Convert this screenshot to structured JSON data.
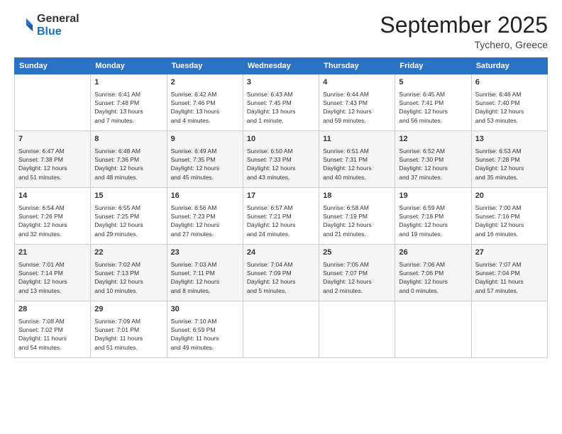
{
  "logo": {
    "general": "General",
    "blue": "Blue"
  },
  "header": {
    "title": "September 2025",
    "subtitle": "Tychero, Greece"
  },
  "days_of_week": [
    "Sunday",
    "Monday",
    "Tuesday",
    "Wednesday",
    "Thursday",
    "Friday",
    "Saturday"
  ],
  "weeks": [
    [
      {
        "day": "",
        "info": ""
      },
      {
        "day": "1",
        "info": "Sunrise: 6:41 AM\nSunset: 7:48 PM\nDaylight: 13 hours\nand 7 minutes."
      },
      {
        "day": "2",
        "info": "Sunrise: 6:42 AM\nSunset: 7:46 PM\nDaylight: 13 hours\nand 4 minutes."
      },
      {
        "day": "3",
        "info": "Sunrise: 6:43 AM\nSunset: 7:45 PM\nDaylight: 13 hours\nand 1 minute."
      },
      {
        "day": "4",
        "info": "Sunrise: 6:44 AM\nSunset: 7:43 PM\nDaylight: 12 hours\nand 59 minutes."
      },
      {
        "day": "5",
        "info": "Sunrise: 6:45 AM\nSunset: 7:41 PM\nDaylight: 12 hours\nand 56 minutes."
      },
      {
        "day": "6",
        "info": "Sunrise: 6:46 AM\nSunset: 7:40 PM\nDaylight: 12 hours\nand 53 minutes."
      }
    ],
    [
      {
        "day": "7",
        "info": "Sunrise: 6:47 AM\nSunset: 7:38 PM\nDaylight: 12 hours\nand 51 minutes."
      },
      {
        "day": "8",
        "info": "Sunrise: 6:48 AM\nSunset: 7:36 PM\nDaylight: 12 hours\nand 48 minutes."
      },
      {
        "day": "9",
        "info": "Sunrise: 6:49 AM\nSunset: 7:35 PM\nDaylight: 12 hours\nand 45 minutes."
      },
      {
        "day": "10",
        "info": "Sunrise: 6:50 AM\nSunset: 7:33 PM\nDaylight: 12 hours\nand 43 minutes."
      },
      {
        "day": "11",
        "info": "Sunrise: 6:51 AM\nSunset: 7:31 PM\nDaylight: 12 hours\nand 40 minutes."
      },
      {
        "day": "12",
        "info": "Sunrise: 6:52 AM\nSunset: 7:30 PM\nDaylight: 12 hours\nand 37 minutes."
      },
      {
        "day": "13",
        "info": "Sunrise: 6:53 AM\nSunset: 7:28 PM\nDaylight: 12 hours\nand 35 minutes."
      }
    ],
    [
      {
        "day": "14",
        "info": "Sunrise: 6:54 AM\nSunset: 7:26 PM\nDaylight: 12 hours\nand 32 minutes."
      },
      {
        "day": "15",
        "info": "Sunrise: 6:55 AM\nSunset: 7:25 PM\nDaylight: 12 hours\nand 29 minutes."
      },
      {
        "day": "16",
        "info": "Sunrise: 6:56 AM\nSunset: 7:23 PM\nDaylight: 12 hours\nand 27 minutes."
      },
      {
        "day": "17",
        "info": "Sunrise: 6:57 AM\nSunset: 7:21 PM\nDaylight: 12 hours\nand 24 minutes."
      },
      {
        "day": "18",
        "info": "Sunrise: 6:58 AM\nSunset: 7:19 PM\nDaylight: 12 hours\nand 21 minutes."
      },
      {
        "day": "19",
        "info": "Sunrise: 6:59 AM\nSunset: 7:18 PM\nDaylight: 12 hours\nand 19 minutes."
      },
      {
        "day": "20",
        "info": "Sunrise: 7:00 AM\nSunset: 7:16 PM\nDaylight: 12 hours\nand 16 minutes."
      }
    ],
    [
      {
        "day": "21",
        "info": "Sunrise: 7:01 AM\nSunset: 7:14 PM\nDaylight: 12 hours\nand 13 minutes."
      },
      {
        "day": "22",
        "info": "Sunrise: 7:02 AM\nSunset: 7:13 PM\nDaylight: 12 hours\nand 10 minutes."
      },
      {
        "day": "23",
        "info": "Sunrise: 7:03 AM\nSunset: 7:11 PM\nDaylight: 12 hours\nand 8 minutes."
      },
      {
        "day": "24",
        "info": "Sunrise: 7:04 AM\nSunset: 7:09 PM\nDaylight: 12 hours\nand 5 minutes."
      },
      {
        "day": "25",
        "info": "Sunrise: 7:05 AM\nSunset: 7:07 PM\nDaylight: 12 hours\nand 2 minutes."
      },
      {
        "day": "26",
        "info": "Sunrise: 7:06 AM\nSunset: 7:06 PM\nDaylight: 12 hours\nand 0 minutes."
      },
      {
        "day": "27",
        "info": "Sunrise: 7:07 AM\nSunset: 7:04 PM\nDaylight: 11 hours\nand 57 minutes."
      }
    ],
    [
      {
        "day": "28",
        "info": "Sunrise: 7:08 AM\nSunset: 7:02 PM\nDaylight: 11 hours\nand 54 minutes."
      },
      {
        "day": "29",
        "info": "Sunrise: 7:09 AM\nSunset: 7:01 PM\nDaylight: 11 hours\nand 51 minutes."
      },
      {
        "day": "30",
        "info": "Sunrise: 7:10 AM\nSunset: 6:59 PM\nDaylight: 11 hours\nand 49 minutes."
      },
      {
        "day": "",
        "info": ""
      },
      {
        "day": "",
        "info": ""
      },
      {
        "day": "",
        "info": ""
      },
      {
        "day": "",
        "info": ""
      }
    ]
  ]
}
